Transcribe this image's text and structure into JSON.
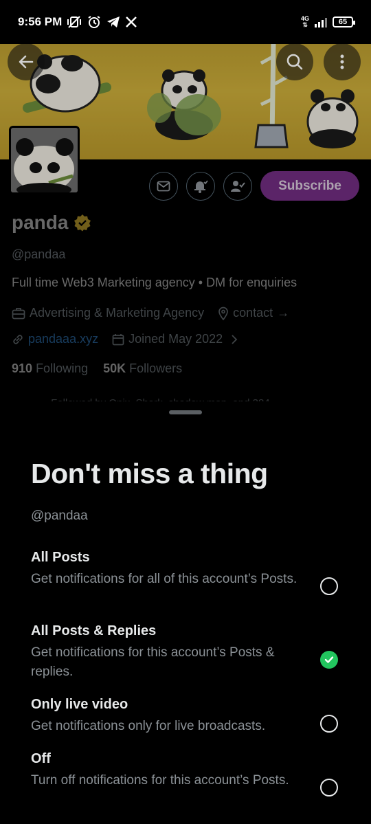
{
  "status_bar": {
    "time": "9:56 PM",
    "network": "4G",
    "battery": "65",
    "icons": [
      "vibrate-off-icon",
      "alarm-icon",
      "telegram-icon",
      "x-logo-icon"
    ]
  },
  "profile": {
    "name": "panda",
    "handle": "@pandaa",
    "bio": "Full time Web3 Marketing agency • DM for enquiries",
    "category": "Advertising & Marketing Agency",
    "location": "contact",
    "location_arrow": "→",
    "website": "pandaaa.xyz",
    "joined": "Joined May 2022",
    "following_count": "910",
    "following_label": "Following",
    "followers_count": "50K",
    "followers_label": "Followers",
    "followed_by": "Followed by Onix, Shark, shadow man, and 384",
    "subscribe_label": "Subscribe",
    "verified_color": "#c9a52b"
  },
  "sheet": {
    "title": "Don't miss a thing",
    "handle": "@pandaa",
    "options": [
      {
        "title": "All Posts",
        "desc": "Get notifications for all of this account’s Posts.",
        "selected": false
      },
      {
        "title": "All Posts & Replies",
        "desc": "Get notifications for this account’s Posts & replies.",
        "selected": true
      },
      {
        "title": "Only live video",
        "desc": "Get notifications only for live broadcasts.",
        "selected": false
      },
      {
        "title": "Off",
        "desc": "Turn off notifications for this account’s Posts.",
        "selected": false
      }
    ],
    "selected_color": "#22c55e"
  }
}
